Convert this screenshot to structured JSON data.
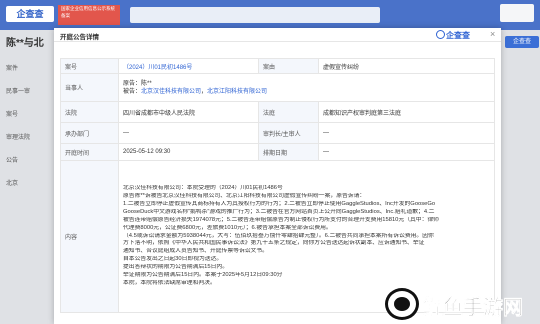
{
  "background": {
    "logo": "企查查",
    "red_tag": "国家企业信用信息公示系统备案",
    "title": "陈**与北",
    "left_items": [
      "案件",
      "民事一审",
      "案号",
      "审理法院",
      "公告",
      "北京"
    ],
    "right_button": "企查查"
  },
  "modal": {
    "title": "开庭公告详情",
    "brand": "企查查",
    "close": "×",
    "rows": {
      "case_no_label": "案号",
      "case_no": "（2024）川01民初1486号",
      "cause_label": "案由",
      "cause": "虚假宣传纠纷",
      "party_label": "当事人",
      "plaintiff": "原告：陈**",
      "defendant_prefix": "被告：",
      "defendant_1": "北京汉佳科技有限公司",
      "defendant_sep": "，",
      "defendant_2": "北京江阳科技有限公司",
      "court_label": "法院",
      "court": "四川省成都市中级人民法院",
      "tribunal_label": "法庭",
      "tribunal": "成都知识产权审判庭第三法庭",
      "dept_label": "承办部门",
      "dept": "—",
      "judge_label": "审判长/主审人",
      "judge": "—",
      "time_label": "开庭时间",
      "time": "2025-05-12 09:30",
      "date_label": "排期日期",
      "date": "—",
      "content_label": "内容",
      "content_lines": [
        "北京汉佳科技有限公司：本院受理的（2024）川01民初1486号",
        "原告陈**诉被告北京汉佳科技有限公司、北京江阳科技有限公司虚假宣传纠纷一案，原告诉请：",
        "1.二被告立即停止虚假宣传其商标持有人为其授权行为的行为；2.二被告立即停止使用GaggleStudios、Inc开发的GooseGo",
        "GooseDuck中文游戏名称“鹅鸭杀”游戏的推广行为；3.二被告在官方网站首页上公开向GaggleStudios、Inc.赔礼道歉；4.二",
        "被告连带赔偿原告经济损失1974078元；5.二被告连带赔偿原告为制止侵权行为所支付的合理开支费用15810元（其中：律师",
        "代理费8000元，公证费6800元，差旅费1010元）；6.被告承担本案全部诉讼费用。",
        "（4.5或诉讼请求金额为5938044元，大写：伍佰玖拾叁万捌仟零肆拾肆元整）。6.二被告共同承担本案所有诉讼费用。因你",
        "方下落不明，依照《中华人民共和国民事诉讼法》第九十五条之规定，向你方公告送达起诉状副本、应诉通知书、举证",
        "通知书、合议庭组成人员告知书、开庭传票等诉讼文书。",
        "自本公告发出之日起30日即视为送达。",
        "提出答辩状的期限为公告期满后15日内。",
        "举证期限为公告期满后15日内。本案于2025年5月12日09:30分",
        "本院，本院将依法缺席审理和判决。"
      ]
    }
  },
  "watermark": {
    "text": "鲤鱼手游网"
  }
}
